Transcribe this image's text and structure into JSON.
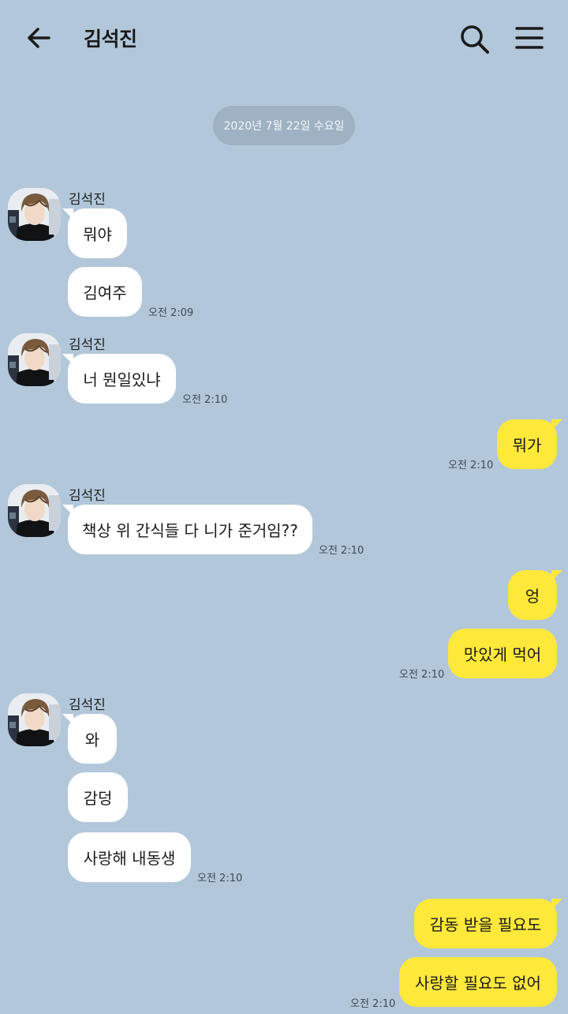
{
  "header": {
    "title": "김석진",
    "back_icon": "arrow-left-icon",
    "search_icon": "search-icon",
    "menu_icon": "hamburger-menu-icon"
  },
  "date_divider": "2020년 7월 22일 수요일",
  "colors": {
    "background": "#b2c7da",
    "incoming_bubble": "#ffffff",
    "outgoing_bubble": "#fee83a",
    "date_pill": "#9eb2c3"
  },
  "messages": {
    "g1": {
      "sender": "김석진",
      "m1": "뭐야",
      "m2": "김여주",
      "time": "오전 2:09"
    },
    "g2": {
      "sender": "김석진",
      "m1": "너 뭔일있냐",
      "time": "오전 2:10"
    },
    "g3": {
      "m1": "뭐가",
      "time": "오전 2:10"
    },
    "g4": {
      "sender": "김석진",
      "m1": "책상 위 간식들 다 니가 준거임??",
      "time": "오전 2:10"
    },
    "g5": {
      "m1": "엉",
      "m2": "맛있게 먹어",
      "time": "오전 2:10"
    },
    "g6": {
      "sender": "김석진",
      "m1": "와",
      "m2": "감덩",
      "m3": "사랑해 내동생",
      "time": "오전 2:10"
    },
    "g7": {
      "m1": "감동 받을 필요도",
      "m2": "사랑할 필요도 없어",
      "time": "오전 2:10"
    }
  }
}
